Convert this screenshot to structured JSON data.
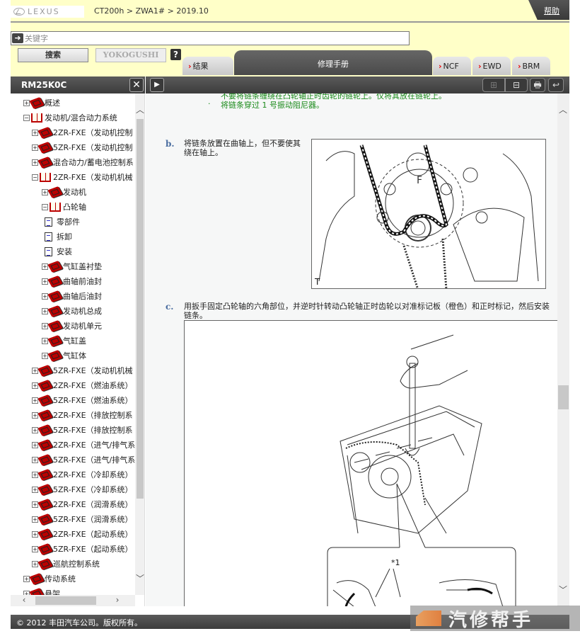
{
  "header": {
    "logo_text": "LEXUS",
    "breadcrumb": "CT200h > ZWA1# > 2019.10",
    "help_label": "帮助"
  },
  "search": {
    "placeholder": "关键字",
    "value": "",
    "search_label": "搜索",
    "yokogushi_label": "YOKOGUSHI",
    "help_q": "?"
  },
  "tabs": {
    "results": "结果",
    "repair_manual": "修理手册",
    "ncf": "NCF",
    "ewd": "EWD",
    "brm": "BRM",
    "chevron": "›"
  },
  "left_panel": {
    "title": "RM25K0C",
    "close": "✕"
  },
  "toolbar": {
    "expand": "▶",
    "plus": "⊞",
    "minus": "⊟",
    "print": "🖶",
    "back": "↩"
  },
  "tree": [
    {
      "label": "概述",
      "level": 0,
      "toggle": "+",
      "icon": "closed"
    },
    {
      "label": "发动机/混合动力系统",
      "level": 0,
      "toggle": "-",
      "icon": "open"
    },
    {
      "label": "2ZR-FXE（发动机控制",
      "level": 1,
      "toggle": "+",
      "icon": "closed"
    },
    {
      "label": "5ZR-FXE（发动机控制",
      "level": 1,
      "toggle": "+",
      "icon": "closed"
    },
    {
      "label": "混合动力/蓄电池控制系",
      "level": 1,
      "toggle": "+",
      "icon": "closed"
    },
    {
      "label": "2ZR-FXE（发动机机械",
      "level": 1,
      "toggle": "-",
      "icon": "open"
    },
    {
      "label": "发动机",
      "level": 2,
      "toggle": "+",
      "icon": "closed"
    },
    {
      "label": "凸轮轴",
      "level": 2,
      "toggle": "-",
      "icon": "open"
    },
    {
      "label": "零部件",
      "level": 3,
      "toggle": "",
      "icon": "doc"
    },
    {
      "label": "拆卸",
      "level": 3,
      "toggle": "",
      "icon": "doc"
    },
    {
      "label": "安装",
      "level": 3,
      "toggle": "",
      "icon": "doc"
    },
    {
      "label": "气缸盖衬垫",
      "level": 2,
      "toggle": "+",
      "icon": "closed"
    },
    {
      "label": "曲轴前油封",
      "level": 2,
      "toggle": "+",
      "icon": "closed"
    },
    {
      "label": "曲轴后油封",
      "level": 2,
      "toggle": "+",
      "icon": "closed"
    },
    {
      "label": "发动机总成",
      "level": 2,
      "toggle": "+",
      "icon": "closed"
    },
    {
      "label": "发动机单元",
      "level": 2,
      "toggle": "+",
      "icon": "closed"
    },
    {
      "label": "气缸盖",
      "level": 2,
      "toggle": "+",
      "icon": "closed"
    },
    {
      "label": "气缸体",
      "level": 2,
      "toggle": "+",
      "icon": "closed"
    },
    {
      "label": "5ZR-FXE（发动机机械",
      "level": 1,
      "toggle": "+",
      "icon": "closed"
    },
    {
      "label": "2ZR-FXE（燃油系统）",
      "level": 1,
      "toggle": "+",
      "icon": "closed"
    },
    {
      "label": "5ZR-FXE（燃油系统）",
      "level": 1,
      "toggle": "+",
      "icon": "closed"
    },
    {
      "label": "2ZR-FXE（排放控制系",
      "level": 1,
      "toggle": "+",
      "icon": "closed"
    },
    {
      "label": "5ZR-FXE（排放控制系",
      "level": 1,
      "toggle": "+",
      "icon": "closed"
    },
    {
      "label": "2ZR-FXE（进气/排气系",
      "level": 1,
      "toggle": "+",
      "icon": "closed"
    },
    {
      "label": "5ZR-FXE（进气/排气系",
      "level": 1,
      "toggle": "+",
      "icon": "closed"
    },
    {
      "label": "2ZR-FXE（冷却系统）",
      "level": 1,
      "toggle": "+",
      "icon": "closed"
    },
    {
      "label": "5ZR-FXE（冷却系统）",
      "level": 1,
      "toggle": "+",
      "icon": "closed"
    },
    {
      "label": "2ZR-FXE（润滑系统）",
      "level": 1,
      "toggle": "+",
      "icon": "closed"
    },
    {
      "label": "5ZR-FXE（润滑系统）",
      "level": 1,
      "toggle": "+",
      "icon": "closed"
    },
    {
      "label": "2ZR-FXE（起动系统）",
      "level": 1,
      "toggle": "+",
      "icon": "closed"
    },
    {
      "label": "5ZR-FXE（起动系统）",
      "level": 1,
      "toggle": "+",
      "icon": "closed"
    },
    {
      "label": "巡航控制系统",
      "level": 1,
      "toggle": "+",
      "icon": "closed"
    },
    {
      "label": "传动系统",
      "level": 0,
      "toggle": "+",
      "icon": "closed"
    },
    {
      "label": "悬架",
      "level": 0,
      "toggle": "+",
      "icon": "closed"
    }
  ],
  "content": {
    "note_partial": "不要将链条缠绕在凸轮轴正时齿轮的链轮上。仅将其放在链轮上。",
    "note_bullet": "·",
    "note_2": "将链条穿过 1 号振动阻尼器。",
    "step_b_letter": "b.",
    "step_b_text": "将链条放置在曲轴上，但不要使其绕在轴上。",
    "fig_b_label": "T",
    "step_c_letter": "c.",
    "step_c_text": "用扳手固定凸轮轴的六角部位，并逆时针转动凸轮轴正时齿轮以对准标记板（橙色）和正时标记，然后安装链条。",
    "fig_c_callout": "*1"
  },
  "footer": {
    "copyright": "© 2012 丰田汽车公司。版权所有。"
  },
  "watermark": {
    "text": "汽修帮手"
  },
  "colors": {
    "header_bg": "#ffffc8",
    "bar_dark": "#4a4a4a",
    "note_green": "#1a8a1a",
    "step_letter_blue": "#4a6da0",
    "book_red": "#bb0000"
  }
}
